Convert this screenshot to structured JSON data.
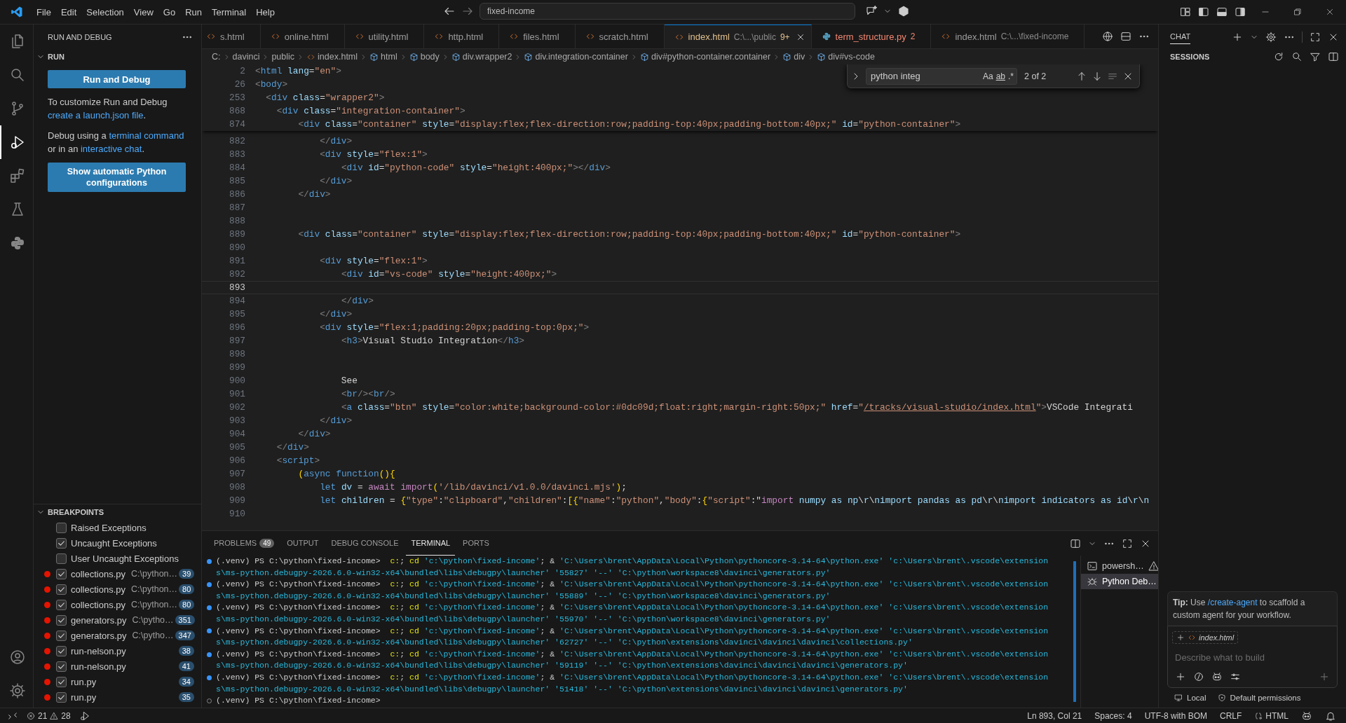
{
  "title_bar": {
    "menu": [
      "File",
      "Edit",
      "Selection",
      "View",
      "Go",
      "Run",
      "Terminal",
      "Help"
    ],
    "command_center": "fixed-income"
  },
  "activity_bar": {
    "items": [
      {
        "kind": "explorer",
        "selected": false
      },
      {
        "kind": "search",
        "selected": false
      },
      {
        "kind": "source-control",
        "selected": false
      },
      {
        "kind": "run-debug",
        "selected": true
      },
      {
        "kind": "extensions",
        "selected": false
      },
      {
        "kind": "testing",
        "selected": false
      },
      {
        "kind": "python",
        "selected": false
      }
    ],
    "bottom": [
      {
        "kind": "account"
      },
      {
        "kind": "settings"
      }
    ]
  },
  "sidebar": {
    "title": "RUN AND DEBUG",
    "section": "RUN",
    "run_button": "Run and Debug",
    "paragraphs": [
      [
        {
          "kind": "text",
          "text": "To customize Run and Debug "
        },
        {
          "kind": "link",
          "text": "create a launch.json file"
        },
        {
          "kind": "text",
          "text": "."
        }
      ],
      [
        {
          "kind": "text",
          "text": "Debug using a "
        },
        {
          "kind": "link",
          "text": "terminal command"
        },
        {
          "kind": "text",
          "text": " or in an "
        },
        {
          "kind": "link",
          "text": "interactive chat"
        },
        {
          "kind": "text",
          "text": "."
        }
      ]
    ],
    "config_button": "Show automatic Python configurations",
    "breakpoints": {
      "title": "BREAKPOINTS",
      "items": [
        {
          "kind": "exception",
          "label": "Raised Exceptions",
          "checked": false
        },
        {
          "kind": "exception",
          "label": "Uncaught Exceptions",
          "checked": true
        },
        {
          "kind": "exception",
          "label": "User Uncaught Exceptions",
          "checked": false
        },
        {
          "kind": "file",
          "label": "collections.py",
          "path": "C:\\python…",
          "line": "39",
          "checked": true
        },
        {
          "kind": "file",
          "label": "collections.py",
          "path": "C:\\python…",
          "line": "80",
          "checked": true
        },
        {
          "kind": "file",
          "label": "collections.py",
          "path": "C:\\python…",
          "line": "80",
          "checked": true
        },
        {
          "kind": "file",
          "label": "generators.py",
          "path": "C:\\pytho…",
          "line": "351",
          "checked": true
        },
        {
          "kind": "file",
          "label": "generators.py",
          "path": "C:\\pytho…",
          "line": "347",
          "checked": true
        },
        {
          "kind": "file",
          "label": "run-nelson.py",
          "line": "38",
          "checked": true
        },
        {
          "kind": "file",
          "label": "run-nelson.py",
          "line": "41",
          "checked": true
        },
        {
          "kind": "file",
          "label": "run.py",
          "line": "34",
          "checked": true
        },
        {
          "kind": "file",
          "label": "run.py",
          "line": "35",
          "checked": true
        }
      ]
    }
  },
  "editor": {
    "tabs": [
      {
        "kind": "html",
        "label": "s.html",
        "selected": false
      },
      {
        "kind": "html",
        "label": "online.html",
        "selected": false
      },
      {
        "kind": "html",
        "label": "utility.html",
        "selected": false
      },
      {
        "kind": "html",
        "label": "http.html",
        "selected": false
      },
      {
        "kind": "html",
        "label": "files.html",
        "selected": false
      },
      {
        "kind": "html",
        "label": "scratch.html",
        "selected": false
      },
      {
        "kind": "html",
        "label": "index.html",
        "description": "C:\\...\\public",
        "problems": "9+",
        "selected": true
      },
      {
        "kind": "python",
        "label": "term_structure.py",
        "problems": "2",
        "selected": false
      },
      {
        "kind": "html",
        "label": "index.html",
        "description": "C:\\...\\fixed-income",
        "selected": false
      }
    ],
    "breadcrumbs": [
      {
        "kind": "folder",
        "label": "C:"
      },
      {
        "kind": "folder",
        "label": "davinci"
      },
      {
        "kind": "folder",
        "label": "public"
      },
      {
        "kind": "file",
        "label": "index.html"
      },
      {
        "kind": "element",
        "label": "html"
      },
      {
        "kind": "element",
        "label": "body"
      },
      {
        "kind": "element",
        "label": "div.wrapper2"
      },
      {
        "kind": "element",
        "label": "div.integration-container"
      },
      {
        "kind": "element",
        "label": "div#python-container.container"
      },
      {
        "kind": "element",
        "label": "div"
      },
      {
        "kind": "element",
        "label": "div#vs-code"
      }
    ],
    "find": {
      "value": "python integ",
      "options": [
        "Aa",
        "ab",
        ".*"
      ],
      "result": "2 of 2"
    },
    "sticky_lines": [
      {
        "num": "2",
        "kind": "markup",
        "text": "<html lang=\"en\">"
      },
      {
        "num": "26",
        "kind": "markup",
        "text": "<body>"
      },
      {
        "num": "253",
        "kind": "markup",
        "text": "  <div class=\"wrapper2\">"
      },
      {
        "num": "868",
        "kind": "markup",
        "text": "    <div class=\"integration-container\">"
      },
      {
        "num": "874",
        "kind": "markup",
        "text": "        <div class=\"container\" style=\"display:flex;flex-direction:row;padding-top:40px;padding-bottom:40px;\" id=\"python-container\">"
      }
    ],
    "lines": [
      {
        "num": "882",
        "kind": "markup",
        "text": "            </div>",
        "current": false
      },
      {
        "num": "883",
        "kind": "markup",
        "text": "            <div style=\"flex:1\">",
        "current": false
      },
      {
        "num": "884",
        "kind": "markup",
        "text": "                <div id=\"python-code\" style=\"height:400px;\"></div>",
        "current": false
      },
      {
        "num": "885",
        "kind": "markup",
        "text": "            </div>",
        "current": false
      },
      {
        "num": "886",
        "kind": "markup",
        "text": "        </div>",
        "current": false
      },
      {
        "num": "887",
        "current": false
      },
      {
        "num": "888",
        "current": false
      },
      {
        "num": "889",
        "kind": "markup",
        "text": "        <div class=\"container\" style=\"display:flex;flex-direction:row;padding-top:40px;padding-bottom:40px;\" id=\"python-container\">",
        "current": false
      },
      {
        "num": "890",
        "current": false
      },
      {
        "num": "891",
        "kind": "markup",
        "text": "            <div style=\"flex:1\">",
        "current": false
      },
      {
        "num": "892",
        "kind": "markup",
        "text": "                <div id=\"vs-code\" style=\"height:400px;\">",
        "current": false
      },
      {
        "num": "893",
        "current": true
      },
      {
        "num": "894",
        "kind": "markup",
        "text": "                </div>",
        "current": false
      },
      {
        "num": "895",
        "kind": "markup",
        "text": "            </div>",
        "current": false
      },
      {
        "num": "896",
        "kind": "markup",
        "text": "            <div style=\"flex:1;padding:20px;padding-top:0px;\">",
        "current": false
      },
      {
        "num": "897",
        "kind": "markup",
        "text": "                <h3>Visual Studio Integration</h3>",
        "current": false
      },
      {
        "num": "898",
        "current": false
      },
      {
        "num": "899",
        "current": false
      },
      {
        "num": "900",
        "kind": "markup",
        "text": "                See",
        "current": false
      },
      {
        "num": "901",
        "kind": "markup",
        "text": "                <br/><br/>",
        "current": false
      },
      {
        "num": "902",
        "kind": "markup",
        "text": "                <a class=\"btn\" style=\"color:white;background-color:#0dc09d;float:right;margin-right:50px;\" href=\"/tracks/visual-studio/index.html\">VSCode Integrati",
        "current": false
      },
      {
        "num": "903",
        "kind": "markup",
        "text": "            </div>",
        "current": false
      },
      {
        "num": "904",
        "kind": "markup",
        "text": "        </div>",
        "current": false
      },
      {
        "num": "905",
        "kind": "markup",
        "text": "    </div>",
        "current": false
      },
      {
        "num": "906",
        "kind": "markup",
        "text": "    <script>",
        "current": false
      },
      {
        "num": "907",
        "kind": "script",
        "text": "        (async function(){",
        "current": false
      },
      {
        "num": "908",
        "kind": "script",
        "text": "            let dv = await import('/lib/davinci/v1.0.0/davinci.mjs');",
        "current": false
      },
      {
        "num": "909",
        "kind": "script",
        "text": "            let children = {\"type\":\"clipboard\",\"children\":[{\"name\":\"python\",\"body\":{\"script\":\"import numpy as np\\r\\nimport pandas as pd\\r\\nimport indicators as id\\r\\n",
        "current": false
      },
      {
        "num": "910",
        "current": false
      }
    ]
  },
  "panel": {
    "tabs": [
      {
        "label": "PROBLEMS",
        "count": "49",
        "selected": false
      },
      {
        "label": "OUTPUT",
        "selected": false
      },
      {
        "label": "DEBUG CONSOLE",
        "selected": false
      },
      {
        "label": "TERMINAL",
        "selected": true
      },
      {
        "label": "PORTS",
        "selected": false
      }
    ],
    "terminal": [
      {
        "succeeded": true,
        "lines": [
          "(.venv) PS C:\\python\\fixed-income>  c:; cd 'c:\\python\\fixed-income'; & 'C:\\Users\\brent\\AppData\\Local\\Python\\pythoncore-3.14-64\\python.exe' 'c:\\Users\\brent\\.vscode\\extension",
          "s\\ms-python.debugpy-2026.6.0-win32-x64\\bundled\\libs\\debugpy\\launcher' '55827' '--' 'C:\\python\\workspace8\\davinci\\generators.py'"
        ]
      },
      {
        "succeeded": true,
        "lines": [
          "(.venv) PS C:\\python\\fixed-income>  c:; cd 'c:\\python\\fixed-income'; & 'C:\\Users\\brent\\AppData\\Local\\Python\\pythoncore-3.14-64\\python.exe' 'c:\\Users\\brent\\.vscode\\extension",
          "s\\ms-python.debugpy-2026.6.0-win32-x64\\bundled\\libs\\debugpy\\launcher' '55889' '--' 'C:\\python\\workspace8\\davinci\\generators.py'"
        ]
      },
      {
        "succeeded": true,
        "lines": [
          "(.venv) PS C:\\python\\fixed-income>  c:; cd 'c:\\python\\fixed-income'; & 'C:\\Users\\brent\\AppData\\Local\\Python\\pythoncore-3.14-64\\python.exe' 'c:\\Users\\brent\\.vscode\\extension",
          "s\\ms-python.debugpy-2026.6.0-win32-x64\\bundled\\libs\\debugpy\\launcher' '55970' '--' 'C:\\python\\workspace8\\davinci\\generators.py'"
        ]
      },
      {
        "succeeded": true,
        "lines": [
          "(.venv) PS C:\\python\\fixed-income>  c:; cd 'c:\\python\\fixed-income'; & 'C:\\Users\\brent\\AppData\\Local\\Python\\pythoncore-3.14-64\\python.exe' 'c:\\Users\\brent\\.vscode\\extension",
          "s\\ms-python.debugpy-2026.6.0-win32-x64\\bundled\\libs\\debugpy\\launcher' '62727' '--' 'C:\\python\\extensions\\davinci\\davinci\\davinci\\collections.py'"
        ]
      },
      {
        "succeeded": true,
        "lines": [
          "(.venv) PS C:\\python\\fixed-income>  c:; cd 'c:\\python\\fixed-income'; & 'C:\\Users\\brent\\AppData\\Local\\Python\\pythoncore-3.14-64\\python.exe' 'c:\\Users\\brent\\.vscode\\extension",
          "s\\ms-python.debugpy-2026.6.0-win32-x64\\bundled\\libs\\debugpy\\launcher' '59119' '--' 'C:\\python\\extensions\\davinci\\davinci\\davinci\\generators.py'"
        ]
      },
      {
        "succeeded": true,
        "lines": [
          "(.venv) PS C:\\python\\fixed-income>  c:; cd 'c:\\python\\fixed-income'; & 'C:\\Users\\brent\\AppData\\Local\\Python\\pythoncore-3.14-64\\python.exe' 'c:\\Users\\brent\\.vscode\\extension",
          "s\\ms-python.debugpy-2026.6.0-win32-x64\\bundled\\libs\\debugpy\\launcher' '51418' '--' 'C:\\python\\extensions\\davinci\\davinci\\davinci\\generators.py'"
        ]
      },
      {
        "succeeded": false,
        "lines": [
          "(.venv) PS C:\\python\\fixed-income>"
        ]
      }
    ],
    "terminal_tabs": [
      {
        "kind": "shell",
        "label": "powersh…",
        "warning": true,
        "selected": false
      },
      {
        "kind": "debug",
        "label": "Python Deb…",
        "warning": false,
        "selected": true
      }
    ]
  },
  "chat": {
    "tab": "CHAT",
    "sessions": "SESSIONS",
    "tip": [
      {
        "kind": "bold",
        "text": "Tip:"
      },
      {
        "kind": "text",
        "text": " Use "
      },
      {
        "kind": "link",
        "text": "/create-agent"
      },
      {
        "kind": "text",
        "text": " to scaffold a custom agent for your workflow."
      }
    ],
    "attachment": "index.html",
    "placeholder": "Describe what to build",
    "footer": [
      {
        "kind": "local",
        "label": "Local"
      },
      {
        "kind": "permissions",
        "label": "Default permissions"
      }
    ]
  },
  "status_bar": {
    "errors": "21",
    "warnings": "28",
    "right": [
      "Ln 893, Col 21",
      "Spaces: 4",
      "UTF-8 with BOM",
      "CRLF"
    ],
    "language": "HTML"
  }
}
